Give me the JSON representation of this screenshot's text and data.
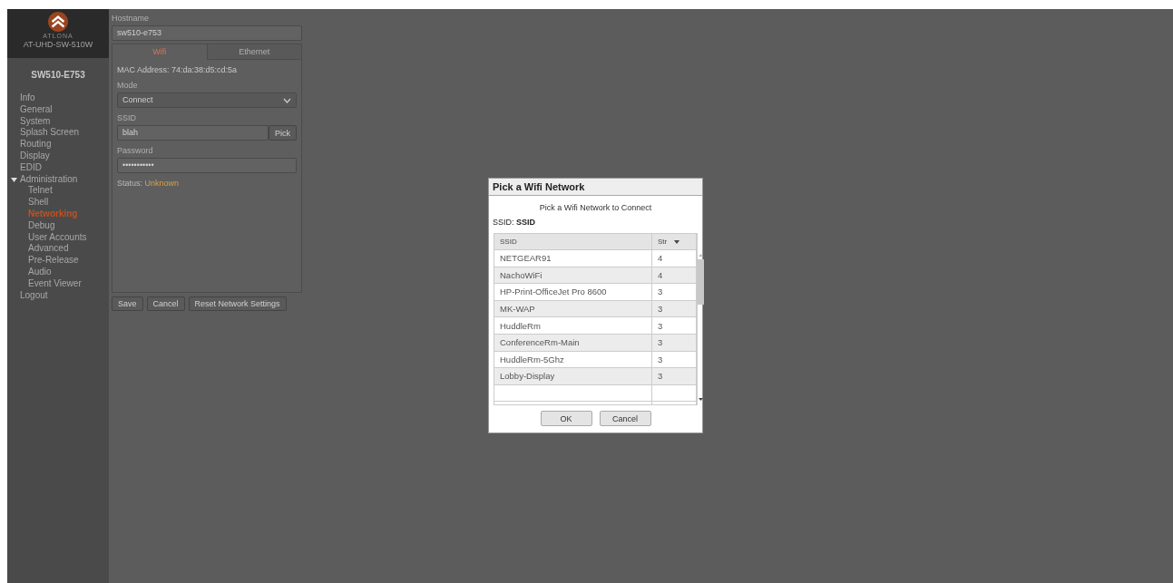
{
  "header": {
    "brand": "ATLONA",
    "model": "AT-UHD-SW-510W"
  },
  "device_name": "SW510-E753",
  "sidebar": {
    "items": [
      {
        "label": "Info",
        "selected": false
      },
      {
        "label": "General",
        "selected": false
      },
      {
        "label": "System",
        "selected": false
      },
      {
        "label": "Splash Screen",
        "selected": false
      },
      {
        "label": "Routing",
        "selected": false
      },
      {
        "label": "Display",
        "selected": false
      },
      {
        "label": "EDID",
        "selected": false
      },
      {
        "label": "Administration",
        "selected": false,
        "expanded": true,
        "children": [
          {
            "label": "Telnet",
            "selected": false
          },
          {
            "label": "Shell",
            "selected": false
          },
          {
            "label": "Networking",
            "selected": true
          },
          {
            "label": "Debug",
            "selected": false
          },
          {
            "label": "User Accounts",
            "selected": false
          },
          {
            "label": "Advanced",
            "selected": false
          },
          {
            "label": "Pre-Release",
            "selected": false
          },
          {
            "label": "Audio",
            "selected": false
          },
          {
            "label": "Event Viewer",
            "selected": false
          }
        ]
      },
      {
        "label": "Logout",
        "selected": false
      }
    ]
  },
  "form": {
    "hostname_label": "Hostname",
    "hostname": "sw510-e753",
    "tabs": [
      {
        "label": "Wifi",
        "selected": true
      },
      {
        "label": "Ethernet",
        "selected": false
      }
    ],
    "mac": "MAC Address: 74:da:38:d5:cd:5a",
    "mode_label": "Mode",
    "mode": "Connect",
    "ssid_label": "SSID",
    "ssid": "blah",
    "pick_button": "Pick",
    "password_label": "Password",
    "password": "•••••••••••",
    "status_label": "Status:",
    "status": "Unknown",
    "buttons": [
      "Save",
      "Cancel",
      "Reset Network Settings"
    ]
  },
  "dialog": {
    "title": "Pick a Wifi Network",
    "subtitle": "Pick a Wifi Network to Connect",
    "ssid_line": "SSID: **SSID**",
    "columns": [
      "SSID",
      "Str"
    ],
    "rows": [
      {
        "ssid": "NETGEAR91",
        "strength": "4"
      },
      {
        "ssid": "NachoWiFi",
        "strength": "4"
      },
      {
        "ssid": "HP-Print-OfficeJet Pro 8600",
        "strength": "3"
      },
      {
        "ssid": "MK-WAP",
        "strength": "3"
      },
      {
        "ssid": "HuddleRm",
        "strength": "3"
      },
      {
        "ssid": "ConferenceRm-Main",
        "strength": "3"
      },
      {
        "ssid": "HuddleRm-5Ghz",
        "strength": "3"
      },
      {
        "ssid": "Lobby-Display",
        "strength": "3"
      }
    ],
    "buttons": [
      "OK",
      "Cancel"
    ]
  }
}
